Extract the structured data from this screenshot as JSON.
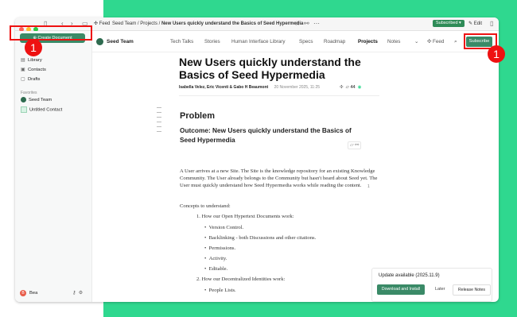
{
  "titlebar": {
    "feed_label": "Feed",
    "breadcrumb_site": "Seed Team",
    "breadcrumb_sep1": "/",
    "breadcrumb_section": "Projects",
    "breadcrumb_sep2": "/",
    "breadcrumb_page": "New Users quickly understand the Basics of Seed Hypermedia",
    "subscribed_label": "Subscribed",
    "edit_label": "Edit"
  },
  "sidebar": {
    "create_label": "Create Document",
    "items": [
      {
        "label": "Library"
      },
      {
        "label": "Contacts"
      },
      {
        "label": "Drafts"
      }
    ],
    "favorites_heading": "Favorites",
    "favorites": [
      {
        "label": "Seed Team"
      },
      {
        "label": "Untitled Contact"
      }
    ],
    "user_initial": "B",
    "user_name": "Bea"
  },
  "nav": {
    "site_name": "Seed Team",
    "items": [
      "Tech Talks",
      "Stories",
      "Human Interface Library",
      "Specs",
      "Roadmap",
      "Projects",
      "Notes"
    ],
    "feed_label": "Feed",
    "subscribe_label": "Subscribe"
  },
  "document": {
    "title": "New Users quickly understand the Basics of Seed Hypermedia",
    "authors": "Isabella Velez, Eric Vicenti & Gabo H Beaumont",
    "date": "20 November 2025, 11:25",
    "comment_count": "44",
    "heading": "Problem",
    "subheading": "Outcome: New Users quickly understand the Basics of Seed Hypermedia",
    "paragraph1": "A User arrives at a new Site. The Site is the knowledge repository for an existing Knowledge Community. The User already belongs to the Community but hasn't heard about Seed yet. The User must quickly understand how Seed Hypermedia works while reading the content.",
    "paragraph2": "Concepts to understand:",
    "list1_num": "1.",
    "list1": "How our Open Hypertext Documents work:",
    "list1_items": [
      "Version Control.",
      "Backlinking - both Discussions and other citations.",
      "Permissions.",
      "Activity.",
      "Editable."
    ],
    "list2_num": "2.",
    "list2": "How our Decentralized Identities work:",
    "list2_items": [
      "People Lists."
    ],
    "side_badge": "1"
  },
  "update": {
    "title": "Update available (2025.11.9)",
    "download_label": "Download and Install",
    "later_label": "Later",
    "release_notes_label": "Release Notes"
  },
  "annotations": {
    "marker1": "1",
    "marker2": "1"
  },
  "colors": {
    "accent": "#3a8a67",
    "background": "#2fd88f",
    "annotation": "#ee1111"
  }
}
